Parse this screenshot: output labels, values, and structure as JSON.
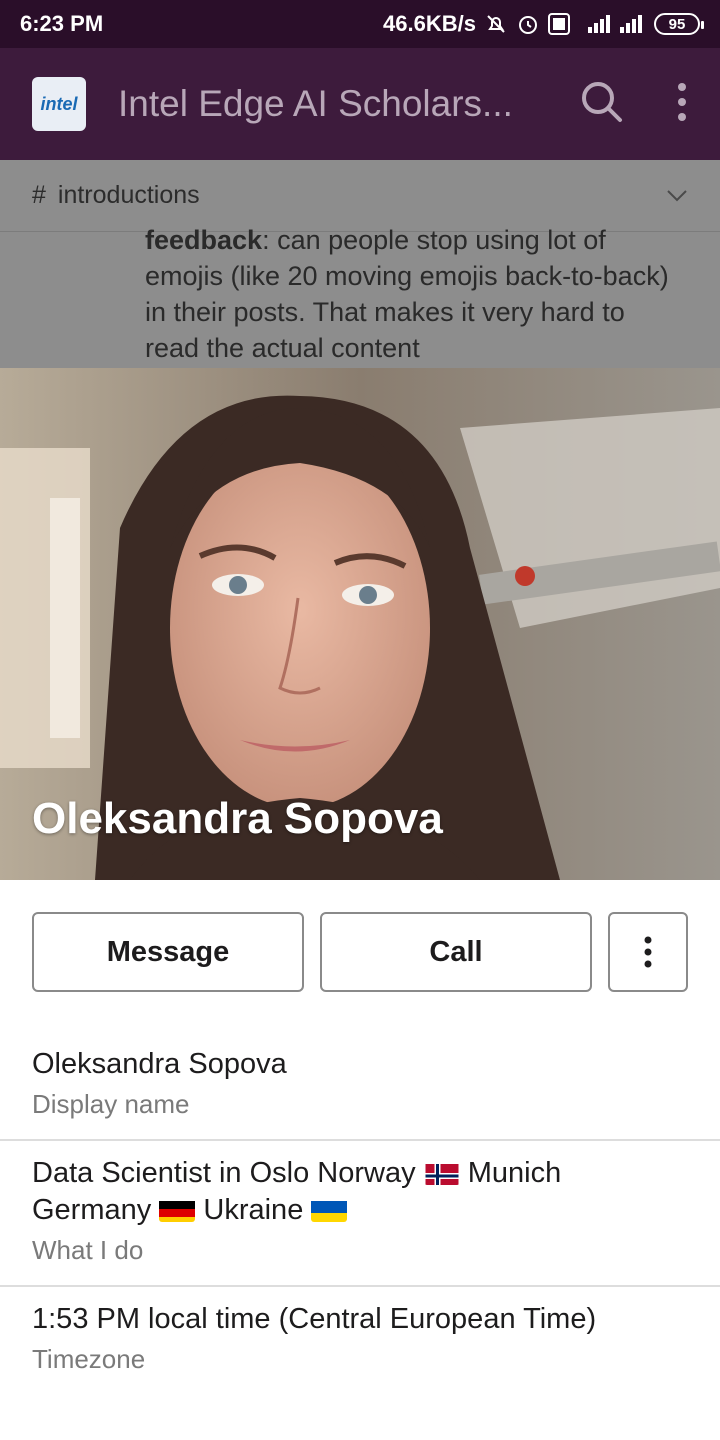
{
  "status_bar": {
    "time": "6:23 PM",
    "net_speed": "46.6KB/s",
    "battery": "95"
  },
  "app_bar": {
    "logo_text": "intel",
    "title": "Intel Edge AI Scholars..."
  },
  "channel": {
    "name": "introductions"
  },
  "message_snippet": {
    "bold": "feedback",
    "text": ": can people stop using lot of emojis (like 20 moving emojis back-to-back) in their posts. That makes it very hard to read the actual content"
  },
  "profile": {
    "name": "Oleksandra Sopova"
  },
  "buttons": {
    "message": "Message",
    "call": "Call"
  },
  "info": {
    "display_name": {
      "value": "Oleksandra Sopova",
      "label": "Display name"
    },
    "what_i_do": {
      "text_1": "Data Scientist in Oslo Norway",
      "text_2": "Munich Germany",
      "text_3": "Ukraine",
      "label": "What I do"
    },
    "timezone": {
      "value": "1:53 PM local time (Central European Time)",
      "label": "Timezone"
    }
  },
  "colors": {
    "status_bar": "#2a0e29",
    "app_bar": "#3d1b3c"
  }
}
